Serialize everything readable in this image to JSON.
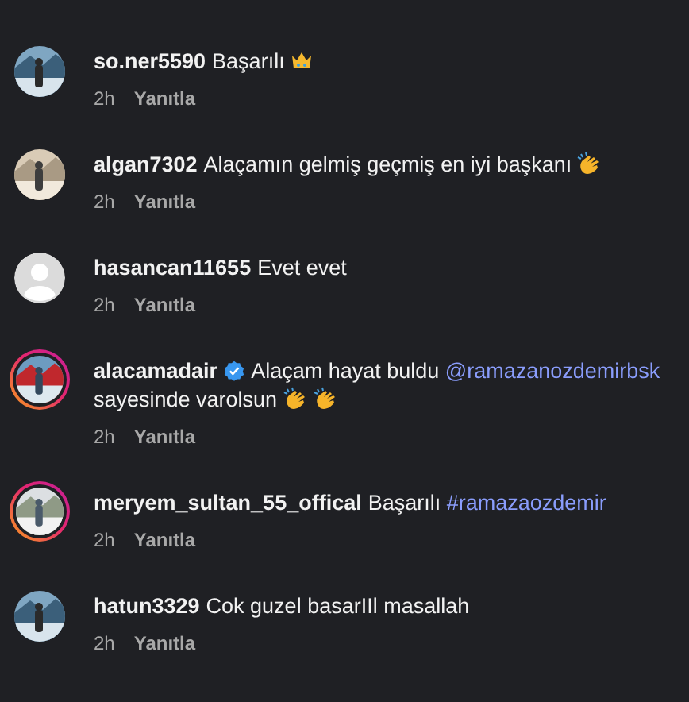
{
  "comments": [
    {
      "username": "so.ner5590",
      "verified": false,
      "story_ring": false,
      "parts": [
        {
          "kind": "text",
          "text": "Başarılı"
        },
        {
          "kind": "crown"
        }
      ],
      "time": "2h",
      "reply": "Yanıtla"
    },
    {
      "username": "algan7302",
      "verified": false,
      "story_ring": false,
      "parts": [
        {
          "kind": "text",
          "text": "Alaçamın gelmiş geçmiş en iyi başkanı"
        },
        {
          "kind": "clap"
        }
      ],
      "time": "2h",
      "reply": "Yanıtla"
    },
    {
      "username": "hasancan11655",
      "verified": false,
      "story_ring": false,
      "kind": "default",
      "parts": [
        {
          "kind": "text",
          "text": "Evet evet"
        }
      ],
      "time": "2h",
      "reply": "Yanıtla"
    },
    {
      "username": "alacamadair",
      "verified": true,
      "story_ring": true,
      "parts": [
        {
          "kind": "text",
          "text": "Alaçam hayat buldu"
        },
        {
          "kind": "link",
          "text": "@ramazanozdemirbsk"
        },
        {
          "kind": "text",
          "text": "sayesinde varolsun"
        },
        {
          "kind": "clap"
        },
        {
          "kind": "clap"
        }
      ],
      "time": "2h",
      "reply": "Yanıtla"
    },
    {
      "username": "meryem_sultan_55_offical",
      "verified": false,
      "story_ring": true,
      "parts": [
        {
          "kind": "text",
          "text": "Başarılı"
        },
        {
          "kind": "link",
          "text": "#ramazaozdemir"
        }
      ],
      "time": "2h",
      "reply": "Yanıtla"
    },
    {
      "username": "hatun3329",
      "verified": false,
      "story_ring": false,
      "parts": [
        {
          "kind": "text",
          "text": "Cok guzel basarIIl masallah"
        }
      ],
      "time": "2h",
      "reply": "Yanıtla"
    }
  ]
}
